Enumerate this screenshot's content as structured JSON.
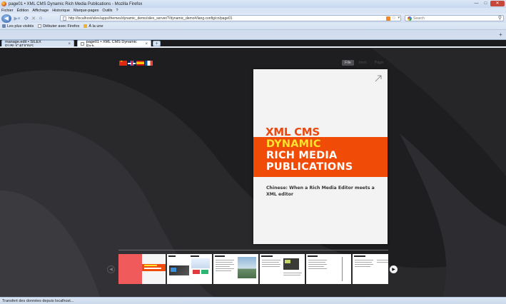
{
  "window": {
    "title": "page01 • XML CMS Dynamic Rich Media Publications - Mozilla Firefox"
  },
  "menu": [
    "Fichier",
    "Édition",
    "Affichage",
    "Historique",
    "Marque-pages",
    "Outils",
    "?"
  ],
  "nav": {
    "url": "http://localhost/silex/apps/themes/dynamic_demo/silex_server/?/dynamic_demo#/lang.config/cn/page01",
    "search_placeholder": "Search"
  },
  "bookmarks": [
    "Les plus visités",
    "Débuter avec Firefox",
    "À la une"
  ],
  "tabs": [
    {
      "label": "manage.edit • SILEX PUBLICATIONS...",
      "active": false
    },
    {
      "label": "page01 • XML CMS Dynamic Rich ...",
      "active": true
    }
  ],
  "page": {
    "languages": [
      {
        "code": "cn",
        "icon": "china-flag-icon"
      },
      {
        "code": "en",
        "icon": "uk-flag-icon"
      },
      {
        "code": "es",
        "icon": "spain-flag-icon"
      },
      {
        "code": "fr",
        "icon": "france-flag-icon"
      }
    ],
    "view_modes": [
      {
        "label": "File",
        "active": true
      },
      {
        "label": "Item",
        "active": false
      },
      {
        "label": "Page",
        "active": false
      }
    ],
    "card": {
      "heading": "XML CMS",
      "band_lines": [
        "DYNAMIC",
        "RICH MEDIA",
        "PUBLICATIONS"
      ],
      "subtitle": "Chinese: When a Rich Media Editor meets a XML editor"
    },
    "colors": {
      "accent": "#f04b07",
      "highlight": "#ffe22e",
      "background": "#1e1e20"
    }
  },
  "status": "Transfert des données depuis localhost..."
}
